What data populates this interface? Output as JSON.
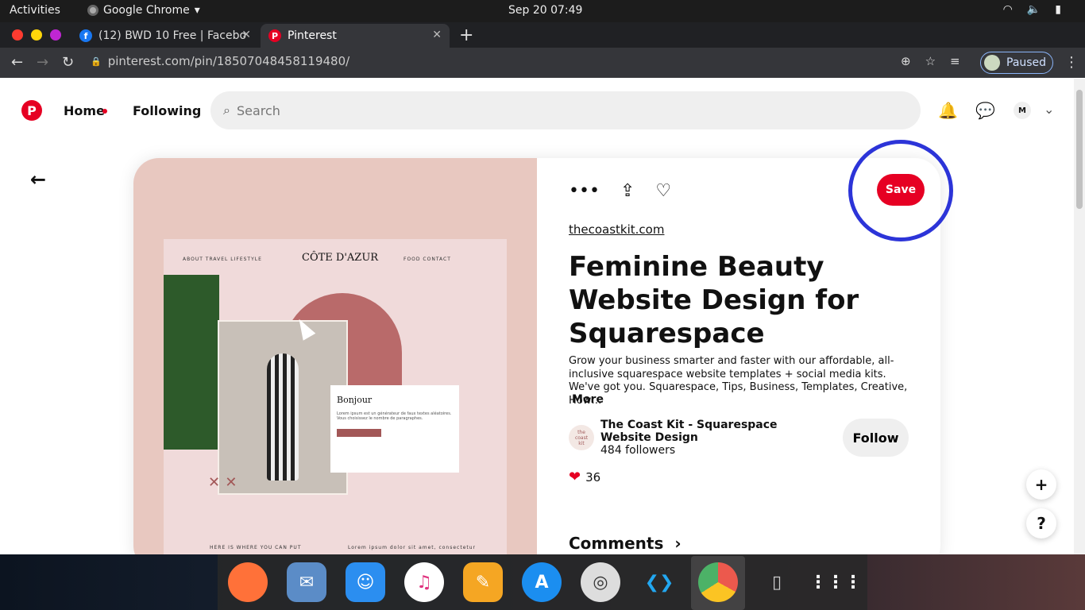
{
  "system_bar": {
    "activities": "Activities",
    "app_name": "Google Chrome",
    "clock": "Sep 20  07:49"
  },
  "browser": {
    "tabs": [
      {
        "title": "(12) BWD 10 Free | Facebo",
        "favicon": "facebook-icon"
      },
      {
        "title": "Pinterest",
        "favicon": "pinterest-icon"
      }
    ],
    "url": "pinterest.com/pin/18507048458119480/",
    "profile_status": "Paused"
  },
  "header": {
    "home": "Home",
    "following": "Following",
    "search_placeholder": "Search",
    "avatar_initial": "M"
  },
  "pin": {
    "source": "thecoastkit.com",
    "title": "Feminine Beauty Website Design for Squarespace",
    "description": "Grow your business smarter and faster with our affordable, all-inclusive squarespace website templates + social media kits. We've got you. Squarespace, Tips, Business, Templates, Creative, How…",
    "more": "More",
    "save": "Save",
    "creator_name": "The Coast Kit - Squarespace Website Design",
    "creator_followers": "484 followers",
    "follow": "Follow",
    "reaction_count": "36",
    "comments": "Comments"
  },
  "pin_image": {
    "nav_left": "ABOUT     TRAVEL     LIFESTYLE",
    "brand": "CÔTE D'AZUR",
    "nav_right": "FOOD     CONTACT",
    "card_title": "Bonjour",
    "card_text": "Lorem ipsum est un générateur de faux textes aléatoires. Vous choisissez le nombre de paragraphes.",
    "footer_left": "HERE IS WHERE YOU CAN PUT",
    "footer_right": "Lorem ipsum dolor sit amet, consectetur"
  },
  "colors": {
    "pinterest_red": "#e60023",
    "highlight_ring": "#2c34d8",
    "image_bg": "#e8c8c0"
  }
}
